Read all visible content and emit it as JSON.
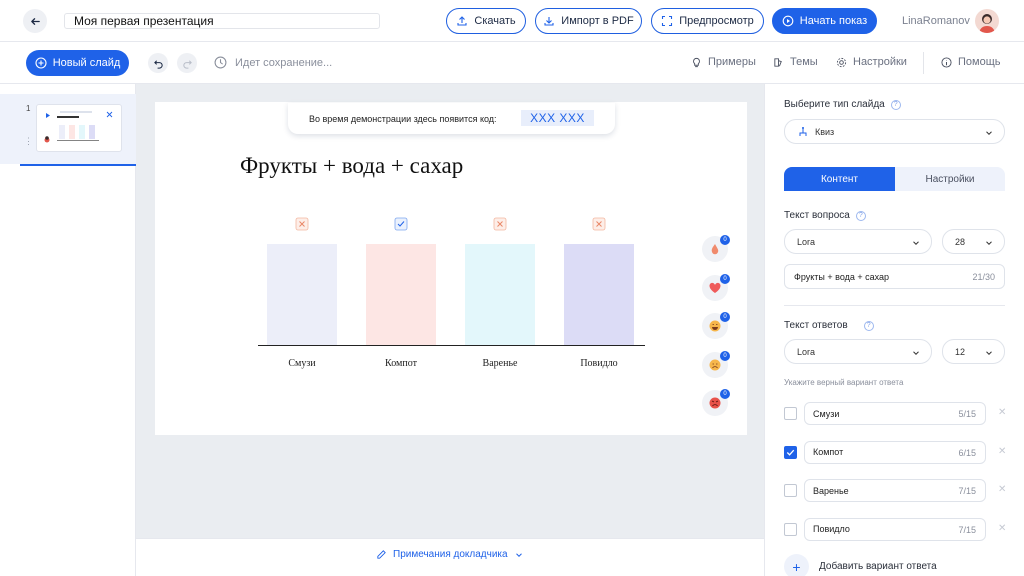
{
  "header": {
    "presentation_title": "Моя первая презентация",
    "download_label": "Скачать",
    "import_pdf_label": "Импорт в PDF",
    "preview_label": "Предпросмотр",
    "start_show_label": "Начать показ",
    "username": "LinaRomanov"
  },
  "toolbar": {
    "new_slide_label": "Новый слайд",
    "saving_status": "Идет сохранение...",
    "examples_label": "Примеры",
    "themes_label": "Темы",
    "settings_label": "Настройки",
    "help_label": "Помощь"
  },
  "slides_panel": {
    "slides": [
      {
        "number": "1"
      }
    ]
  },
  "slide": {
    "code_prompt": "Во время демонстрации здесь появится код:",
    "code_value": "XXX XXX",
    "question": "Фрукты + вода + сахар"
  },
  "chart_data": {
    "type": "bar",
    "categories": [
      "Смузи",
      "Компот",
      "Варенье",
      "Повидло"
    ],
    "values": [
      0,
      0,
      0,
      0
    ],
    "correct": [
      false,
      true,
      false,
      false
    ],
    "colors": [
      "#eceef9",
      "#fde6e4",
      "#e3f7fb",
      "#dcdcf6"
    ],
    "ylim": [
      0,
      1
    ]
  },
  "reactions": [
    {
      "icon": "thumbs-up-icon",
      "count": "0"
    },
    {
      "icon": "heart-icon",
      "count": "0"
    },
    {
      "icon": "laugh-icon",
      "count": "0"
    },
    {
      "icon": "sad-icon",
      "count": "0"
    },
    {
      "icon": "angry-icon",
      "count": "0"
    }
  ],
  "notes": {
    "label": "Примечания докладчика"
  },
  "settings_panel": {
    "slide_type_label": "Выберите тип слайда",
    "slide_type_value": "Квиз",
    "tab_content": "Контент",
    "tab_settings": "Настройки",
    "question_text_label": "Текст вопроса",
    "question_font": "Lora",
    "question_size": "28",
    "question_value": "Фрукты + вода + сахар",
    "question_counter": "21/30",
    "answers_text_label": "Текст ответов",
    "answers_font": "Lora",
    "answers_size": "12",
    "correct_hint": "Укажите верный вариант ответа",
    "answers": [
      {
        "label": "Смузи",
        "counter": "5/15",
        "checked": false
      },
      {
        "label": "Компот",
        "counter": "6/15",
        "checked": true
      },
      {
        "label": "Варенье",
        "counter": "7/15",
        "checked": false
      },
      {
        "label": "Повидло",
        "counter": "7/15",
        "checked": false
      }
    ],
    "add_answer_label": "Добавить вариант ответа"
  },
  "colors": {
    "accent": "#1f62e8",
    "canvas_bg": "#eaedf1"
  }
}
